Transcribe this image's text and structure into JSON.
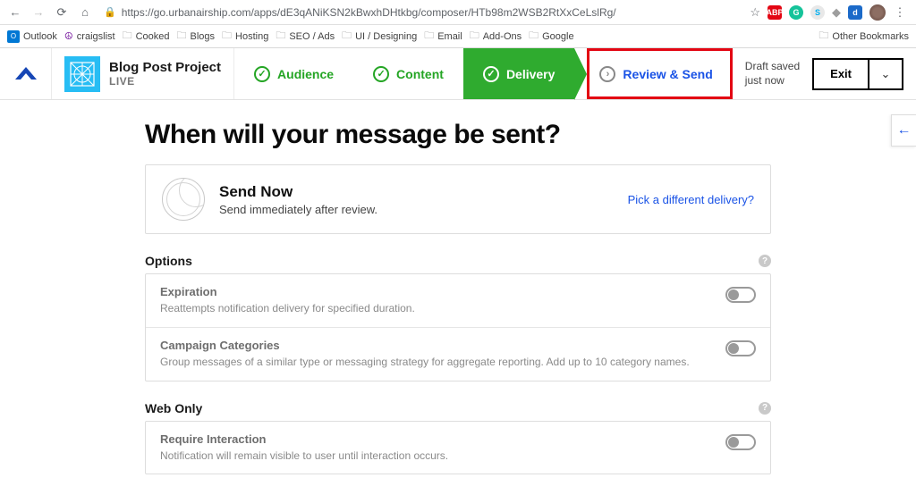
{
  "browser": {
    "url": "https://go.urbanairship.com/apps/dE3qANiKSN2kBwxhDHtkbg/composer/HTb98m2WSB2RtXxCeLslRg/",
    "bookmarks": [
      "Outlook",
      "craigslist",
      "Cooked",
      "Blogs",
      "Hosting",
      "SEO / Ads",
      "UI / Designing",
      "Email",
      "Add-Ons",
      "Google"
    ],
    "other_bookmarks": "Other Bookmarks"
  },
  "project": {
    "title": "Blog Post Project",
    "status": "LIVE"
  },
  "steps": {
    "audience": "Audience",
    "content": "Content",
    "delivery": "Delivery",
    "review": "Review & Send"
  },
  "header": {
    "draft_line1": "Draft saved",
    "draft_line2": "just now",
    "exit": "Exit"
  },
  "page": {
    "heading": "When will your message be sent?",
    "send_now_title": "Send Now",
    "send_now_sub": "Send immediately after review.",
    "pick_link": "Pick a different delivery?"
  },
  "sections": {
    "options": "Options",
    "web_only": "Web Only"
  },
  "options": {
    "expiration_title": "Expiration",
    "expiration_desc": "Reattempts notification delivery for specified duration.",
    "campaign_title": "Campaign Categories",
    "campaign_desc": "Group messages of a similar type or messaging strategy for aggregate reporting. Add up to 10 category names.",
    "require_title": "Require Interaction",
    "require_desc": "Notification will remain visible to user until interaction occurs."
  }
}
